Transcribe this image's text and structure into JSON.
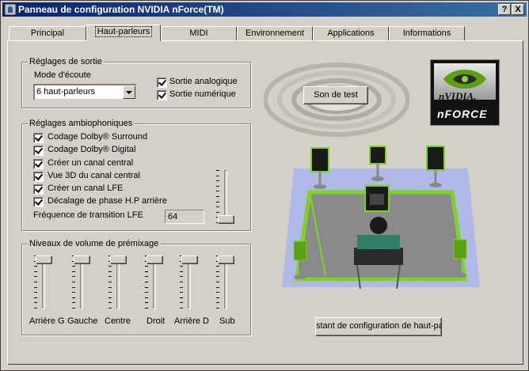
{
  "window": {
    "title": "Panneau de configuration NVIDIA nForce(TM)",
    "help_label": "?",
    "close_label": "X"
  },
  "tabs": [
    {
      "label": "Principal"
    },
    {
      "label": "Haut-parleurs"
    },
    {
      "label": "MIDI"
    },
    {
      "label": "Environnement"
    },
    {
      "label": "Applications"
    },
    {
      "label": "Informations"
    }
  ],
  "active_tab": "Haut-parleurs",
  "output": {
    "legend": "Réglages de sortie",
    "mode_label": "Mode d'écoute",
    "mode_value": "6 haut-parleurs",
    "analog": {
      "label": "Sortie analogique",
      "checked": true
    },
    "digital": {
      "label": "Sortie numérique",
      "checked": true
    }
  },
  "test_button": "Son de test",
  "logo": {
    "brand": "nVIDIA.",
    "product": "nFORCE",
    "icon": "nvidia-eye-icon"
  },
  "surround": {
    "legend": "Réglages ambiophoniques",
    "options": [
      {
        "label": "Codage Dolby® Surround",
        "checked": true
      },
      {
        "label": "Codage Dolby® Digital",
        "checked": true
      },
      {
        "label": "Créer un canal central",
        "checked": true
      },
      {
        "label": "Vue 3D du canal central",
        "checked": true
      },
      {
        "label": "Créer un canal LFE",
        "checked": true
      },
      {
        "label": "Décalage de phase H.P arrière",
        "checked": true
      }
    ],
    "lfe_label": "Fréquence de transition LFE",
    "lfe_value": "64",
    "lfe_level": 0.0
  },
  "premix": {
    "legend": "Niveaux de volume de prémixage",
    "channels": [
      {
        "label": "Arrière G",
        "level": 1.0
      },
      {
        "label": "Gauche",
        "level": 1.0
      },
      {
        "label": "Centre",
        "level": 1.0
      },
      {
        "label": "Droit",
        "level": 1.0
      },
      {
        "label": "Arrière D",
        "level": 1.0
      },
      {
        "label": "Sub",
        "level": 1.0
      }
    ]
  },
  "wizard_button": "stant de configuration de haut-par",
  "colors": {
    "accent_green": "#7ed321",
    "title_blue": "#0a246a",
    "floor_grey": "#8a8a8a",
    "room_blue": "#b0b8e8"
  }
}
